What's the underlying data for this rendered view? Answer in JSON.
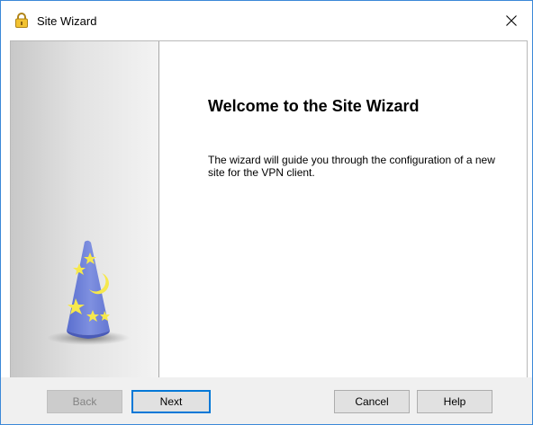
{
  "window": {
    "title": "Site Wizard",
    "icon": "padlock-icon"
  },
  "content": {
    "heading": "Welcome to the Site Wizard",
    "description": "The wizard will guide you through the configuration of a new site for the VPN client."
  },
  "buttons": {
    "back": "Back",
    "next": "Next",
    "cancel": "Cancel",
    "help": "Help"
  },
  "colors": {
    "border_accent": "#3b88d8",
    "default_button": "#0078d7",
    "hat_blue": "#6b80d6",
    "star_yellow": "#f6e84c"
  }
}
